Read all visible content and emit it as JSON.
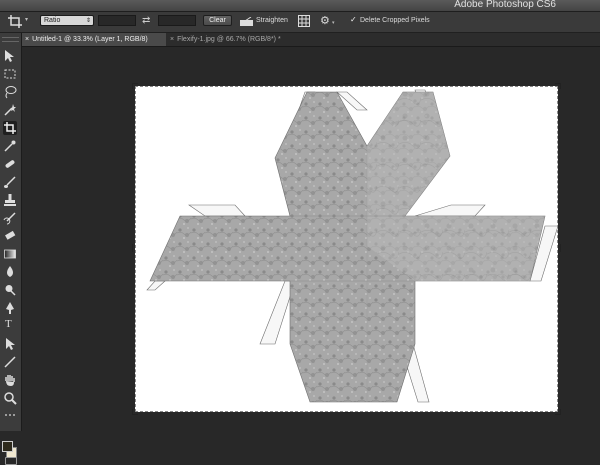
{
  "titlebar": {
    "title": "Adobe Photoshop CS6"
  },
  "options": {
    "ratio_value": "Ratio",
    "width_value": "",
    "height_value": "",
    "clear_label": "Clear",
    "straighten_label": "Straighten",
    "delete_cropped_checked": true,
    "delete_cropped_label": "Delete Cropped Pixels"
  },
  "tabs": [
    {
      "label": "Untitled-1 @ 33.3% (Layer 1, RGB/8)",
      "active": true
    },
    {
      "label": "Flexify-1.jpg @ 66.7% (RGB/8*) *",
      "active": false
    }
  ],
  "toolbar": {
    "icons": [
      "move-icon",
      "marquee-icon",
      "lasso-icon",
      "quick-select-icon",
      "crop-icon",
      "eyedropper-icon",
      "healing-icon",
      "brush-icon",
      "stamp-icon",
      "history-brush-icon",
      "eraser-icon",
      "gradient-icon",
      "blur-icon",
      "dodge-icon",
      "pen-icon",
      "type-icon",
      "path-select-icon",
      "line-icon",
      "hand-icon",
      "zoom-icon"
    ],
    "active": "crop-icon",
    "type_glyph": "T"
  },
  "colors": {
    "foreground": "#2e2a1c",
    "background": "#f0e8d0",
    "document": "#ffffff",
    "map_texture": "#a3a3a3"
  }
}
